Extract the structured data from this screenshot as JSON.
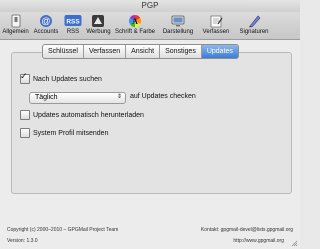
{
  "window": {
    "title": "PGP"
  },
  "toolbar": {
    "items": [
      {
        "label": "Allgemein",
        "icon": "switch-icon"
      },
      {
        "label": "Accounts",
        "icon": "at-icon"
      },
      {
        "label": "RSS",
        "icon": "rss-icon"
      },
      {
        "label": "Werbung",
        "icon": "ad-icon"
      },
      {
        "label": "Schrift & Farbe",
        "icon": "color-wheel-icon"
      },
      {
        "label": "Darstellung",
        "icon": "display-icon"
      },
      {
        "label": "Verfassen",
        "icon": "compose-icon"
      },
      {
        "label": "Signaturen",
        "icon": "pen-icon"
      }
    ]
  },
  "tabs": [
    "Schlüssel",
    "Verfassen",
    "Ansicht",
    "Sonstiges",
    "Updates"
  ],
  "active_tab": "Updates",
  "options": {
    "check_updates": "Nach Updates suchen",
    "frequency": "Täglich",
    "frequency_suffix": "auf Updates checken",
    "auto_download": "Updates automatisch herunterladen",
    "system_profile": "System Profil mitsenden"
  },
  "footer": {
    "copyright": "Copyright (c) 2000–2010 – GPGMail Project Team",
    "contact": "Kontakt: gpgmail-devel@lists.gpgmail.org",
    "version": "Version: 1.3.0",
    "url": "http://www.gpgmail.org"
  },
  "colors": {
    "rss_badge": "#3a6fd0",
    "tab_active": "#3d7bd4"
  }
}
